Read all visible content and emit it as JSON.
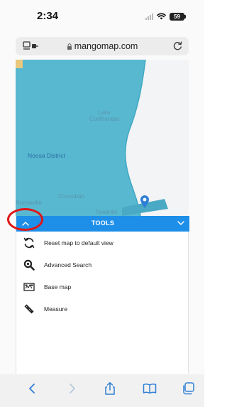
{
  "status_bar": {
    "time": "2:34",
    "battery": "59"
  },
  "browser": {
    "url": "mangomap.com"
  },
  "map": {
    "labels": [
      "Lake\nCootharaba",
      "Noosa District",
      "Cooroibah",
      "Noosaville",
      "Tewantin"
    ],
    "colors": {
      "water": "#58b8d0",
      "sea": "#f3f4f5",
      "marker": "#2f7fd6"
    }
  },
  "tools_panel": {
    "title": "TOOLS",
    "accent": "#1e8fe8",
    "items": [
      {
        "label": "Reset map to default view",
        "icon": "reset-icon"
      },
      {
        "label": "Advanced Search",
        "icon": "search-icon"
      },
      {
        "label": "Base map",
        "icon": "basemap-icon"
      },
      {
        "label": "Measure",
        "icon": "ruler-icon"
      }
    ]
  },
  "annotation": {
    "color": "#e01616"
  },
  "bottom_bar": {
    "items": [
      "back-icon",
      "forward-icon",
      "share-icon",
      "bookmarks-icon",
      "tabs-icon"
    ]
  }
}
